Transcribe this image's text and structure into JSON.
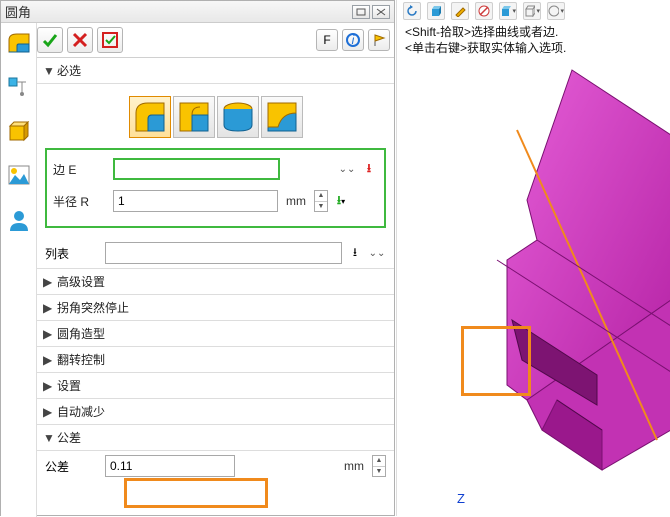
{
  "window": {
    "title": "圆角"
  },
  "toolbar": {
    "f_label": "F"
  },
  "sections": {
    "required": {
      "label": "必选"
    },
    "edge_label": "边 E",
    "radius_label": "半径 R",
    "radius_value": "1",
    "radius_unit": "mm",
    "list_label": "列表",
    "advanced": "高级设置",
    "corner_stop": "拐角突然停止",
    "fillet_shape": "圆角造型",
    "flip_control": "翻转控制",
    "settings": "设置",
    "auto_reduce": "自动减少",
    "tolerance_header": "公差",
    "tolerance_label": "公差",
    "tolerance_value": "0.11",
    "tolerance_unit": "mm"
  },
  "hints": {
    "line1": "<Shift-拾取>选择曲线或者边.",
    "line2": "<单击右键>获取实体输入选项."
  },
  "axis": {
    "z": "Z"
  }
}
